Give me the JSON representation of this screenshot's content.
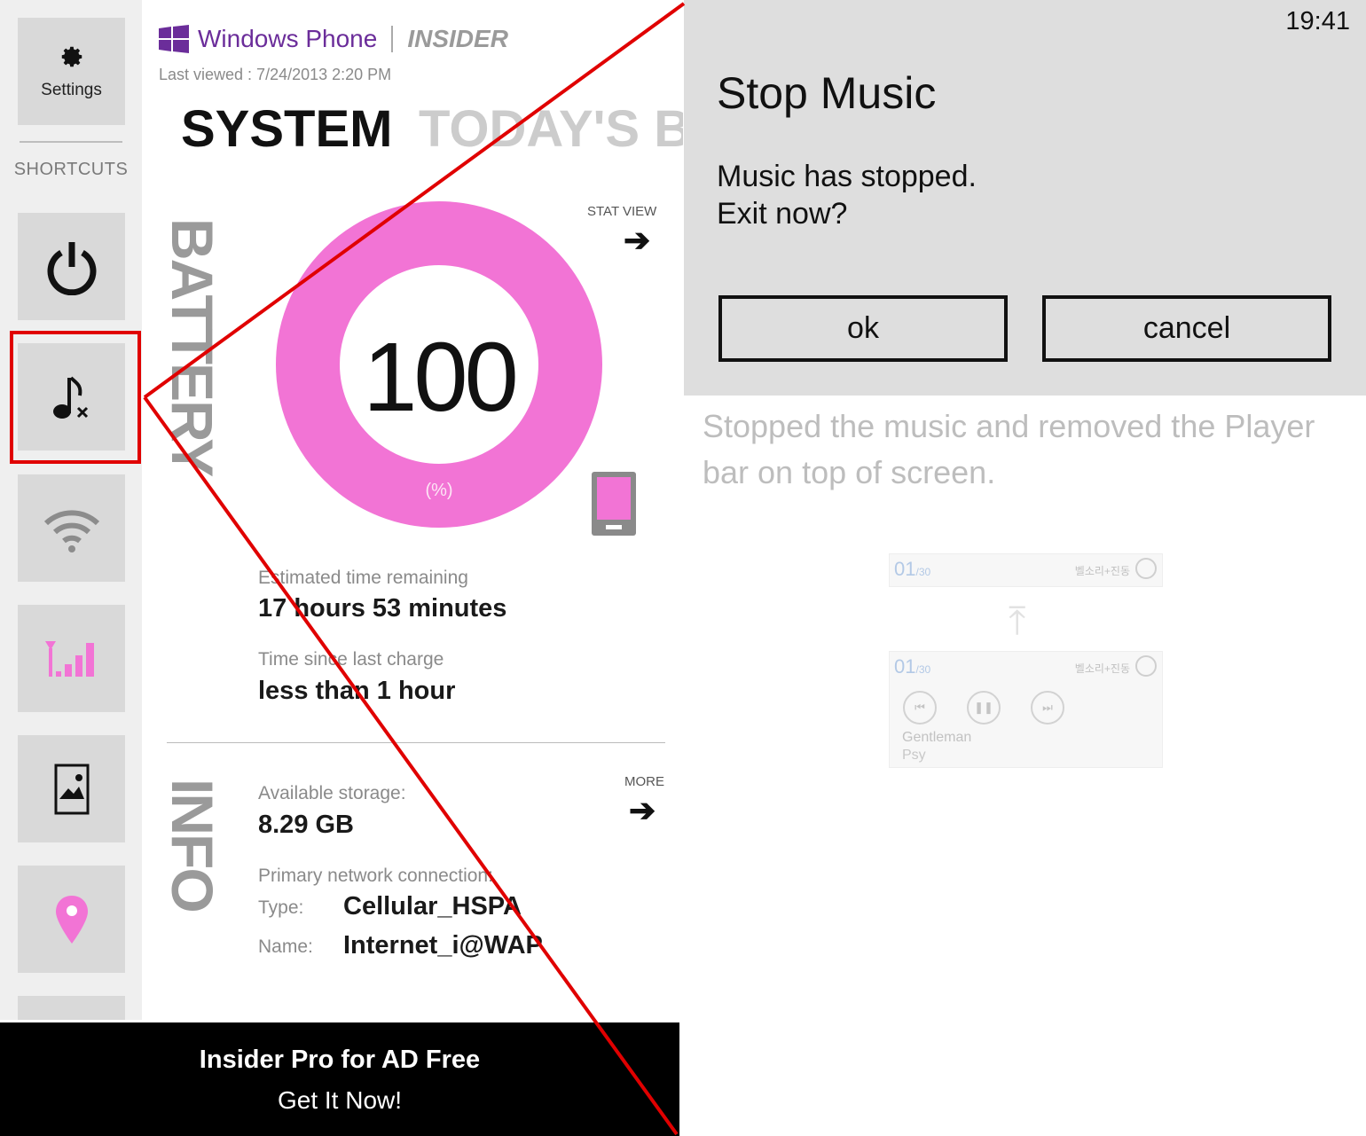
{
  "sidebar": {
    "settings_label": "Settings",
    "section_label": "SHORTCUTS",
    "shortcuts": [
      "power-icon",
      "music-stop-icon",
      "wifi-icon",
      "cellular-signal-icon",
      "picture-icon",
      "location-pin-icon"
    ]
  },
  "app": {
    "brand_name": "Windows Phone",
    "brand_product": "INSIDER",
    "last_viewed": "Last viewed : 7/24/2013 2:20 PM",
    "tabs": [
      "SYSTEM",
      "TODAY'S B"
    ],
    "battery": {
      "section_label": "BATTERY",
      "percent": "100",
      "percent_value": 100,
      "unit": "(%)",
      "stat_view": "STAT VIEW",
      "remaining_label": "Estimated time remaining",
      "remaining_value": "17 hours 53 minutes",
      "since_charge_label": "Time since last charge",
      "since_charge_value": "less than 1 hour"
    },
    "info": {
      "section_label": "INFO",
      "more": "MORE",
      "storage_label": "Available storage:",
      "storage_value": "8.29 GB",
      "network_label": "Primary network connection:",
      "type_label": "Type:",
      "type_value": "Cellular_HSPA",
      "name_label": "Name:",
      "name_value": "Internet_i@WAP"
    }
  },
  "ad": {
    "line1": "Insider Pro for AD Free",
    "line2": "Get It Now!"
  },
  "dialog": {
    "time": "19:41",
    "title": "Stop Music",
    "message_line1": "Music has stopped.",
    "message_line2": "Exit now?",
    "ok": "ok",
    "cancel": "cancel"
  },
  "description": {
    "line1": "Stopped the music and removed the Player",
    "line2": "bar on top of screen."
  },
  "player_preview": {
    "track": "01",
    "track_total": "/30",
    "ringtone": "벨소리+진동",
    "song": "Gentleman",
    "artist": "Psy"
  },
  "colors": {
    "accent_pink": "#f274d5",
    "brand_purple": "#6b2d9a",
    "callout_red": "#e00000"
  }
}
